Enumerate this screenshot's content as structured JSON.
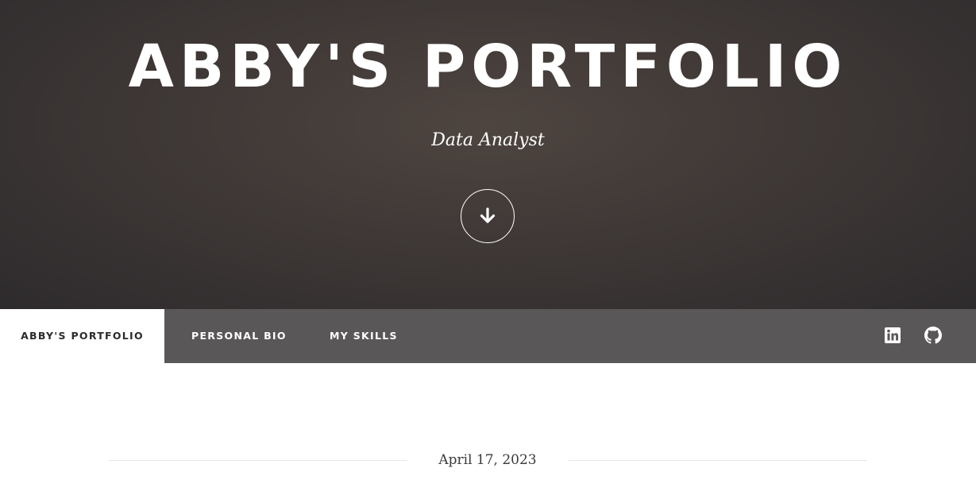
{
  "hero": {
    "title": "ABBY'S PORTFOLIO",
    "subtitle": "Data Analyst",
    "scroll_icon": "arrow-down-icon"
  },
  "nav": {
    "items": [
      {
        "label": "ABBY'S PORTFOLIO",
        "active": true
      },
      {
        "label": "PERSONAL BIO",
        "active": false
      },
      {
        "label": "MY SKILLS",
        "active": false
      }
    ],
    "social": [
      {
        "icon": "linkedin-icon"
      },
      {
        "icon": "github-icon"
      }
    ]
  },
  "post": {
    "date": "April 17, 2023"
  },
  "colors": {
    "hero_bg": "#3f3836",
    "navbar_bg": "#5a5758",
    "nav_active_bg": "#ffffff",
    "nav_active_text": "#2d2a2b",
    "text_light": "#ffffff"
  }
}
